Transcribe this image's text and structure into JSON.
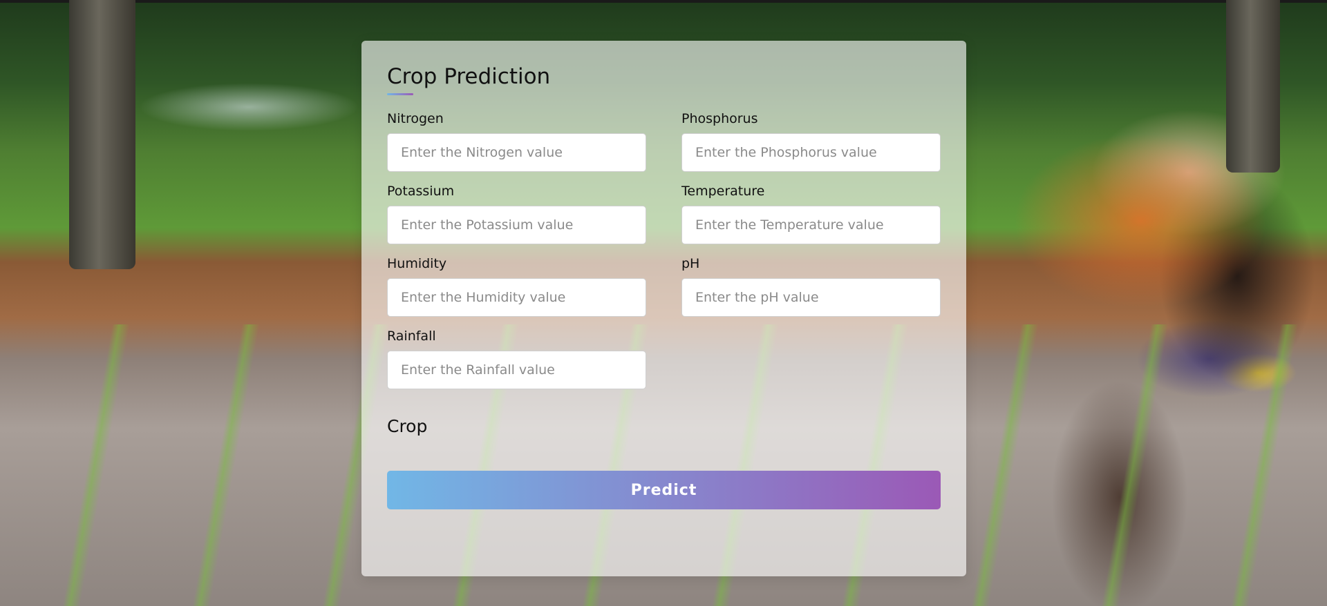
{
  "form": {
    "title": "Crop Prediction",
    "fields": [
      {
        "label": "Nitrogen",
        "placeholder": "Enter the Nitrogen value",
        "value": ""
      },
      {
        "label": "Phosphorus",
        "placeholder": "Enter the Phosphorus value",
        "value": ""
      },
      {
        "label": "Potassium",
        "placeholder": "Enter the Potassium value",
        "value": ""
      },
      {
        "label": "Temperature",
        "placeholder": "Enter the Temperature value",
        "value": ""
      },
      {
        "label": "Humidity",
        "placeholder": "Enter the Humidity value",
        "value": ""
      },
      {
        "label": "pH",
        "placeholder": "Enter the pH value",
        "value": ""
      },
      {
        "label": "Rainfall",
        "placeholder": "Enter the Rainfall value",
        "value": ""
      }
    ],
    "result_label": "Crop",
    "predict_label": "Predict"
  },
  "colors": {
    "accent_start": "#71b7e6",
    "accent_end": "#9b59b6"
  }
}
